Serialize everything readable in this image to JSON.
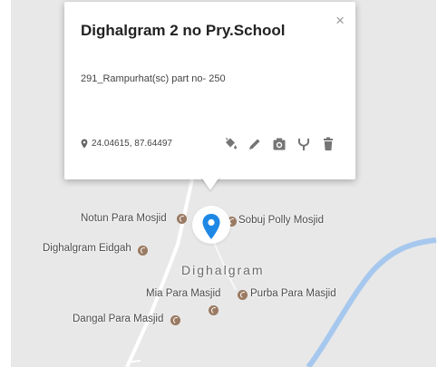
{
  "popup": {
    "title": "Dighalgram 2 no Pry.School",
    "close": "×",
    "description": "291_Rampurhat(sc) part no- 250",
    "coordinates": "24.04615, 87.64497"
  },
  "toolbar": [
    {
      "icon": "paint-bucket-icon"
    },
    {
      "icon": "pencil-icon"
    },
    {
      "icon": "camera-icon"
    },
    {
      "icon": "directions-icon"
    },
    {
      "icon": "trash-icon"
    }
  ],
  "map": {
    "town": "Dighalgram",
    "places": [
      {
        "name": "notun-para-mosjid",
        "label": "Notun Para Mosjid"
      },
      {
        "name": "sobuj-polly-mosjid",
        "label": "Sobuj Polly Mosjid"
      },
      {
        "name": "dighalgram-eidgah",
        "label": "Dighalgram Eidgah"
      },
      {
        "name": "mia-para-masjid",
        "label": "Mia Para Masjid"
      },
      {
        "name": "purba-para-masjid",
        "label": "Purba Para Masjid"
      },
      {
        "name": "dangal-para-masjid",
        "label": "Dangal Para Masjid"
      }
    ],
    "colors": {
      "background": "#e8e8e8",
      "marker": "#1e88e5",
      "mosque_icon": "#9a7a62",
      "river": "#a7c8ee"
    }
  }
}
